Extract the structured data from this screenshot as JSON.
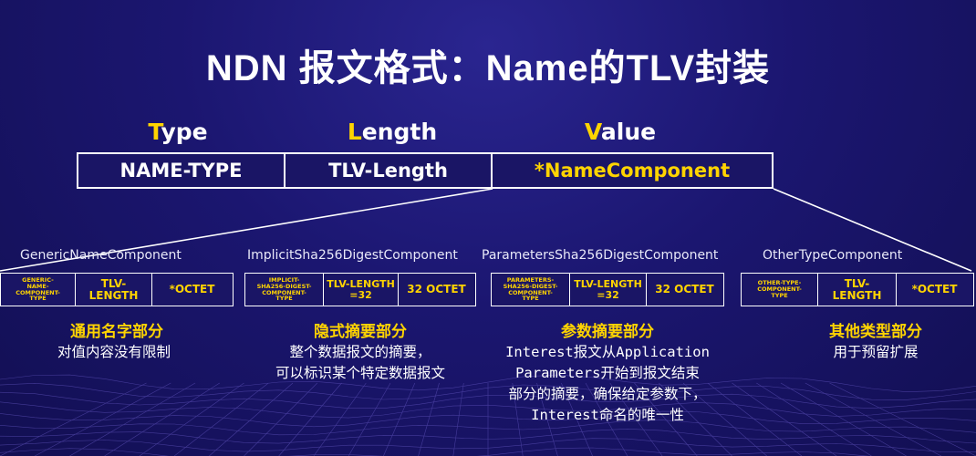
{
  "title": "NDN 报文格式：Name的TLV封装",
  "headers": {
    "type": {
      "first": "T",
      "rest": "ype"
    },
    "length": {
      "first": "L",
      "rest": "ength"
    },
    "value": {
      "first": "V",
      "rest": "alue"
    }
  },
  "tlv_row": [
    "NAME-TYPE",
    "TLV-Length",
    "*NameComponent"
  ],
  "components": [
    {
      "name": "GenericNameComponent",
      "cells": [
        "GENERIC-\nNAME-\nCOMPONENT-\nTYPE",
        "TLV-\nLENGTH",
        "*OCTET"
      ],
      "category": "通用名字部分",
      "desc": [
        "对值内容没有限制"
      ]
    },
    {
      "name": "ImplicitSha256DigestComponent",
      "cells": [
        "IMPLICIT-\nSHA256-DIGEST-\nCOMPONENT-\nTYPE",
        "TLV-LENGTH\n=32",
        "32 OCTET"
      ],
      "category": "隐式摘要部分",
      "desc": [
        "整个数据报文的摘要，",
        "可以标识某个特定数据报文"
      ]
    },
    {
      "name": "ParametersSha256DigestComponent",
      "cells": [
        "PARAMETERS-\nSHA256-DIGEST-\nCOMPONENT-\nTYPE",
        "TLV-LENGTH\n=32",
        "32 OCTET"
      ],
      "category": "参数摘要部分",
      "desc": [
        "Interest报文从Application",
        "Parameters开始到报文结束",
        "部分的摘要，确保给定参数下，",
        "Interest命名的唯一性"
      ]
    },
    {
      "name": "OtherTypeComponent",
      "cells": [
        "OTHER-TYPE-\nCOMPONENT-\nTYPE",
        "TLV-\nLENGTH",
        "*OCTET"
      ],
      "category": "其他类型部分",
      "desc": [
        "用于预留扩展"
      ]
    }
  ],
  "colors": {
    "accent": "#ffd400",
    "background": "#1b1670",
    "line": "#ffffff"
  }
}
